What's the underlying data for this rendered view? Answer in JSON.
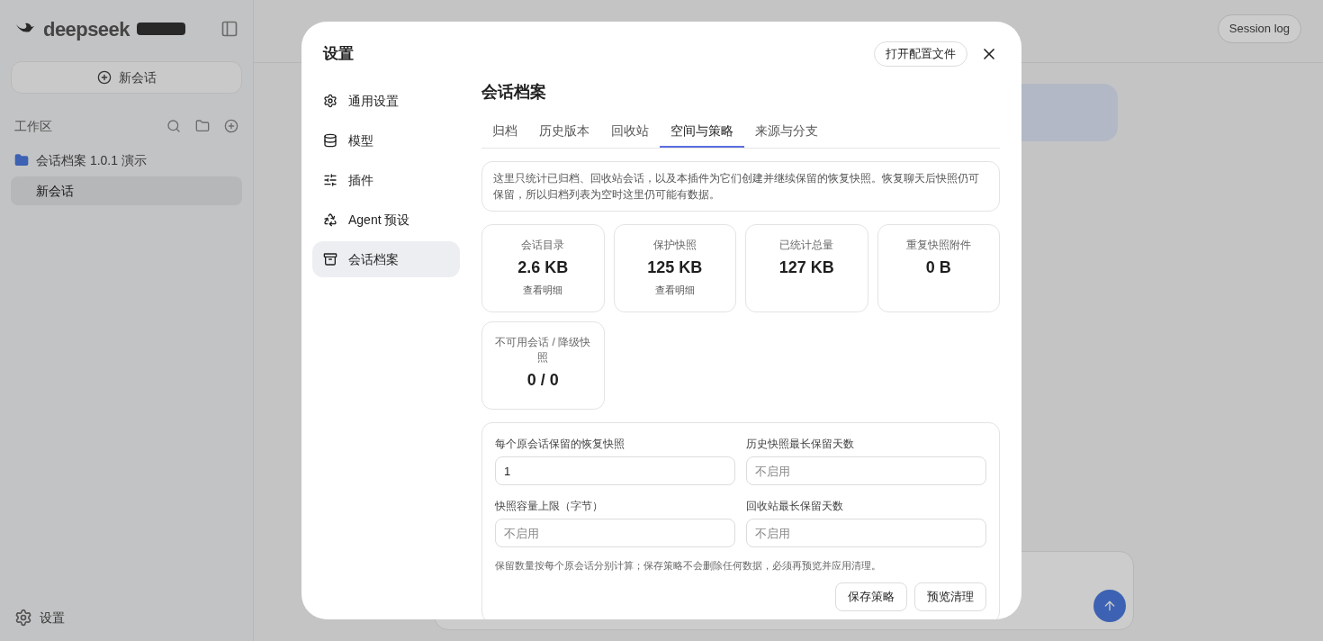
{
  "background": {
    "brand": "deepseek",
    "new_chat": "新会话",
    "workspace_label": "工作区",
    "project": "会话档案 1.0.1 演示",
    "chats": [
      {
        "label": "新会话",
        "selected": true
      }
    ],
    "settings": "设置",
    "session_log": "Session log"
  },
  "dialog": {
    "title": "设置",
    "open_config": "打开配置文件",
    "nav": [
      {
        "label": "通用设置",
        "selected": false
      },
      {
        "label": "模型",
        "selected": false
      },
      {
        "label": "插件",
        "selected": false
      },
      {
        "label": "Agent 预设",
        "selected": false
      },
      {
        "label": "会话档案",
        "selected": true
      }
    ],
    "heading": "会话档案",
    "tabs": [
      {
        "label": "归档",
        "selected": false
      },
      {
        "label": "历史版本",
        "selected": false
      },
      {
        "label": "回收站",
        "selected": false
      },
      {
        "label": "空间与策略",
        "selected": true
      },
      {
        "label": "来源与分支",
        "selected": false
      }
    ],
    "notice": "这里只统计已归档、回收站会话，以及本插件为它们创建并继续保留的恢复快照。恢复聊天后快照仍可保留，所以归档列表为空时这里仍可能有数据。",
    "stats": [
      {
        "label": "会话目录",
        "value": "2.6 KB",
        "link": "查看明细"
      },
      {
        "label": "保护快照",
        "value": "125 KB",
        "link": "查看明细"
      },
      {
        "label": "已统计总量",
        "value": "127 KB"
      },
      {
        "label": "重复快照附件",
        "value": "0 B"
      },
      {
        "label": "不可用会话 / 降级快照",
        "value": "0 / 0"
      }
    ],
    "fields": [
      {
        "label": "每个原会话保留的恢复快照",
        "value": "1"
      },
      {
        "label": "历史快照最长保留天数",
        "placeholder": "不启用"
      },
      {
        "label": "快照容量上限（字节）",
        "placeholder": "不启用"
      },
      {
        "label": "回收站最长保留天数",
        "placeholder": "不启用"
      }
    ],
    "policy_note": "保留数量按每个原会话分别计算；保存策略不会删除任何数据，必须再预览并应用清理。",
    "buttons": [
      "保存策略",
      "预览清理"
    ]
  }
}
